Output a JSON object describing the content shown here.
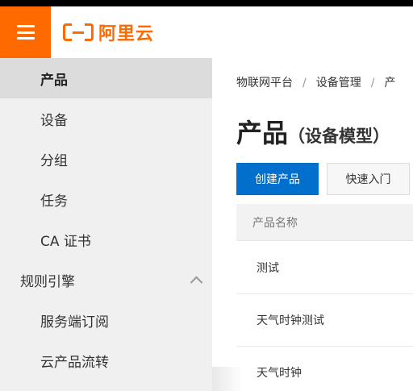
{
  "brand": {
    "logo_text": "阿里云",
    "accent": "#ff6a00"
  },
  "sidebar": {
    "items": [
      {
        "label": "产品",
        "active": true
      },
      {
        "label": "设备"
      },
      {
        "label": "分组"
      },
      {
        "label": "任务"
      },
      {
        "label": "CA 证书"
      },
      {
        "label": "规则引擎",
        "group": true,
        "expanded": true
      },
      {
        "label": "服务端订阅"
      },
      {
        "label": "云产品流转"
      }
    ]
  },
  "breadcrumb": [
    "物联网平台",
    "设备管理",
    "产"
  ],
  "page": {
    "title": "产品",
    "subtitle": "（设备模型）"
  },
  "actions": {
    "create_label": "创建产品",
    "quickstart_label": "快速入门",
    "primary_color": "#0070cc"
  },
  "table": {
    "columns": [
      "产品名称"
    ],
    "rows": [
      {
        "name": "测试"
      },
      {
        "name": "天气时钟测试"
      },
      {
        "name": "天气时钟"
      }
    ]
  }
}
